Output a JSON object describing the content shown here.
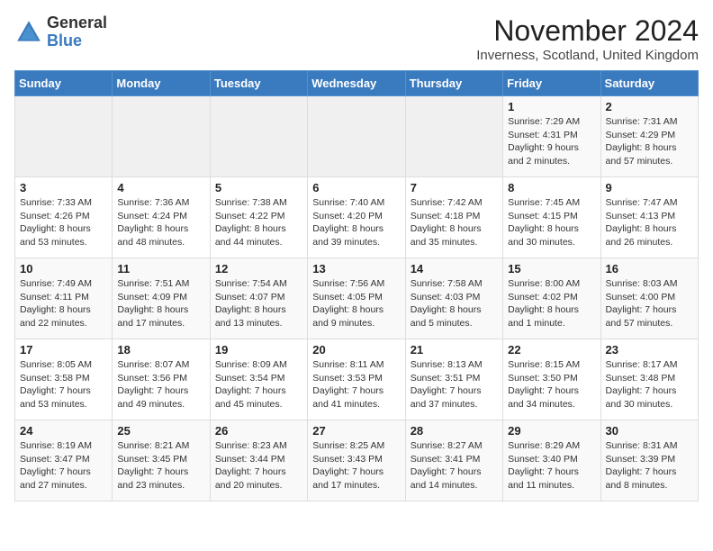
{
  "header": {
    "logo_general": "General",
    "logo_blue": "Blue",
    "month_title": "November 2024",
    "location": "Inverness, Scotland, United Kingdom"
  },
  "days_of_week": [
    "Sunday",
    "Monday",
    "Tuesday",
    "Wednesday",
    "Thursday",
    "Friday",
    "Saturday"
  ],
  "weeks": [
    [
      {
        "day": "",
        "sunrise": "",
        "sunset": "",
        "daylight": "",
        "empty": true
      },
      {
        "day": "",
        "sunrise": "",
        "sunset": "",
        "daylight": "",
        "empty": true
      },
      {
        "day": "",
        "sunrise": "",
        "sunset": "",
        "daylight": "",
        "empty": true
      },
      {
        "day": "",
        "sunrise": "",
        "sunset": "",
        "daylight": "",
        "empty": true
      },
      {
        "day": "",
        "sunrise": "",
        "sunset": "",
        "daylight": "",
        "empty": true
      },
      {
        "day": "1",
        "sunrise": "Sunrise: 7:29 AM",
        "sunset": "Sunset: 4:31 PM",
        "daylight": "Daylight: 9 hours and 2 minutes.",
        "empty": false
      },
      {
        "day": "2",
        "sunrise": "Sunrise: 7:31 AM",
        "sunset": "Sunset: 4:29 PM",
        "daylight": "Daylight: 8 hours and 57 minutes.",
        "empty": false
      }
    ],
    [
      {
        "day": "3",
        "sunrise": "Sunrise: 7:33 AM",
        "sunset": "Sunset: 4:26 PM",
        "daylight": "Daylight: 8 hours and 53 minutes.",
        "empty": false
      },
      {
        "day": "4",
        "sunrise": "Sunrise: 7:36 AM",
        "sunset": "Sunset: 4:24 PM",
        "daylight": "Daylight: 8 hours and 48 minutes.",
        "empty": false
      },
      {
        "day": "5",
        "sunrise": "Sunrise: 7:38 AM",
        "sunset": "Sunset: 4:22 PM",
        "daylight": "Daylight: 8 hours and 44 minutes.",
        "empty": false
      },
      {
        "day": "6",
        "sunrise": "Sunrise: 7:40 AM",
        "sunset": "Sunset: 4:20 PM",
        "daylight": "Daylight: 8 hours and 39 minutes.",
        "empty": false
      },
      {
        "day": "7",
        "sunrise": "Sunrise: 7:42 AM",
        "sunset": "Sunset: 4:18 PM",
        "daylight": "Daylight: 8 hours and 35 minutes.",
        "empty": false
      },
      {
        "day": "8",
        "sunrise": "Sunrise: 7:45 AM",
        "sunset": "Sunset: 4:15 PM",
        "daylight": "Daylight: 8 hours and 30 minutes.",
        "empty": false
      },
      {
        "day": "9",
        "sunrise": "Sunrise: 7:47 AM",
        "sunset": "Sunset: 4:13 PM",
        "daylight": "Daylight: 8 hours and 26 minutes.",
        "empty": false
      }
    ],
    [
      {
        "day": "10",
        "sunrise": "Sunrise: 7:49 AM",
        "sunset": "Sunset: 4:11 PM",
        "daylight": "Daylight: 8 hours and 22 minutes.",
        "empty": false
      },
      {
        "day": "11",
        "sunrise": "Sunrise: 7:51 AM",
        "sunset": "Sunset: 4:09 PM",
        "daylight": "Daylight: 8 hours and 17 minutes.",
        "empty": false
      },
      {
        "day": "12",
        "sunrise": "Sunrise: 7:54 AM",
        "sunset": "Sunset: 4:07 PM",
        "daylight": "Daylight: 8 hours and 13 minutes.",
        "empty": false
      },
      {
        "day": "13",
        "sunrise": "Sunrise: 7:56 AM",
        "sunset": "Sunset: 4:05 PM",
        "daylight": "Daylight: 8 hours and 9 minutes.",
        "empty": false
      },
      {
        "day": "14",
        "sunrise": "Sunrise: 7:58 AM",
        "sunset": "Sunset: 4:03 PM",
        "daylight": "Daylight: 8 hours and 5 minutes.",
        "empty": false
      },
      {
        "day": "15",
        "sunrise": "Sunrise: 8:00 AM",
        "sunset": "Sunset: 4:02 PM",
        "daylight": "Daylight: 8 hours and 1 minute.",
        "empty": false
      },
      {
        "day": "16",
        "sunrise": "Sunrise: 8:03 AM",
        "sunset": "Sunset: 4:00 PM",
        "daylight": "Daylight: 7 hours and 57 minutes.",
        "empty": false
      }
    ],
    [
      {
        "day": "17",
        "sunrise": "Sunrise: 8:05 AM",
        "sunset": "Sunset: 3:58 PM",
        "daylight": "Daylight: 7 hours and 53 minutes.",
        "empty": false
      },
      {
        "day": "18",
        "sunrise": "Sunrise: 8:07 AM",
        "sunset": "Sunset: 3:56 PM",
        "daylight": "Daylight: 7 hours and 49 minutes.",
        "empty": false
      },
      {
        "day": "19",
        "sunrise": "Sunrise: 8:09 AM",
        "sunset": "Sunset: 3:54 PM",
        "daylight": "Daylight: 7 hours and 45 minutes.",
        "empty": false
      },
      {
        "day": "20",
        "sunrise": "Sunrise: 8:11 AM",
        "sunset": "Sunset: 3:53 PM",
        "daylight": "Daylight: 7 hours and 41 minutes.",
        "empty": false
      },
      {
        "day": "21",
        "sunrise": "Sunrise: 8:13 AM",
        "sunset": "Sunset: 3:51 PM",
        "daylight": "Daylight: 7 hours and 37 minutes.",
        "empty": false
      },
      {
        "day": "22",
        "sunrise": "Sunrise: 8:15 AM",
        "sunset": "Sunset: 3:50 PM",
        "daylight": "Daylight: 7 hours and 34 minutes.",
        "empty": false
      },
      {
        "day": "23",
        "sunrise": "Sunrise: 8:17 AM",
        "sunset": "Sunset: 3:48 PM",
        "daylight": "Daylight: 7 hours and 30 minutes.",
        "empty": false
      }
    ],
    [
      {
        "day": "24",
        "sunrise": "Sunrise: 8:19 AM",
        "sunset": "Sunset: 3:47 PM",
        "daylight": "Daylight: 7 hours and 27 minutes.",
        "empty": false
      },
      {
        "day": "25",
        "sunrise": "Sunrise: 8:21 AM",
        "sunset": "Sunset: 3:45 PM",
        "daylight": "Daylight: 7 hours and 23 minutes.",
        "empty": false
      },
      {
        "day": "26",
        "sunrise": "Sunrise: 8:23 AM",
        "sunset": "Sunset: 3:44 PM",
        "daylight": "Daylight: 7 hours and 20 minutes.",
        "empty": false
      },
      {
        "day": "27",
        "sunrise": "Sunrise: 8:25 AM",
        "sunset": "Sunset: 3:43 PM",
        "daylight": "Daylight: 7 hours and 17 minutes.",
        "empty": false
      },
      {
        "day": "28",
        "sunrise": "Sunrise: 8:27 AM",
        "sunset": "Sunset: 3:41 PM",
        "daylight": "Daylight: 7 hours and 14 minutes.",
        "empty": false
      },
      {
        "day": "29",
        "sunrise": "Sunrise: 8:29 AM",
        "sunset": "Sunset: 3:40 PM",
        "daylight": "Daylight: 7 hours and 11 minutes.",
        "empty": false
      },
      {
        "day": "30",
        "sunrise": "Sunrise: 8:31 AM",
        "sunset": "Sunset: 3:39 PM",
        "daylight": "Daylight: 7 hours and 8 minutes.",
        "empty": false
      }
    ]
  ]
}
